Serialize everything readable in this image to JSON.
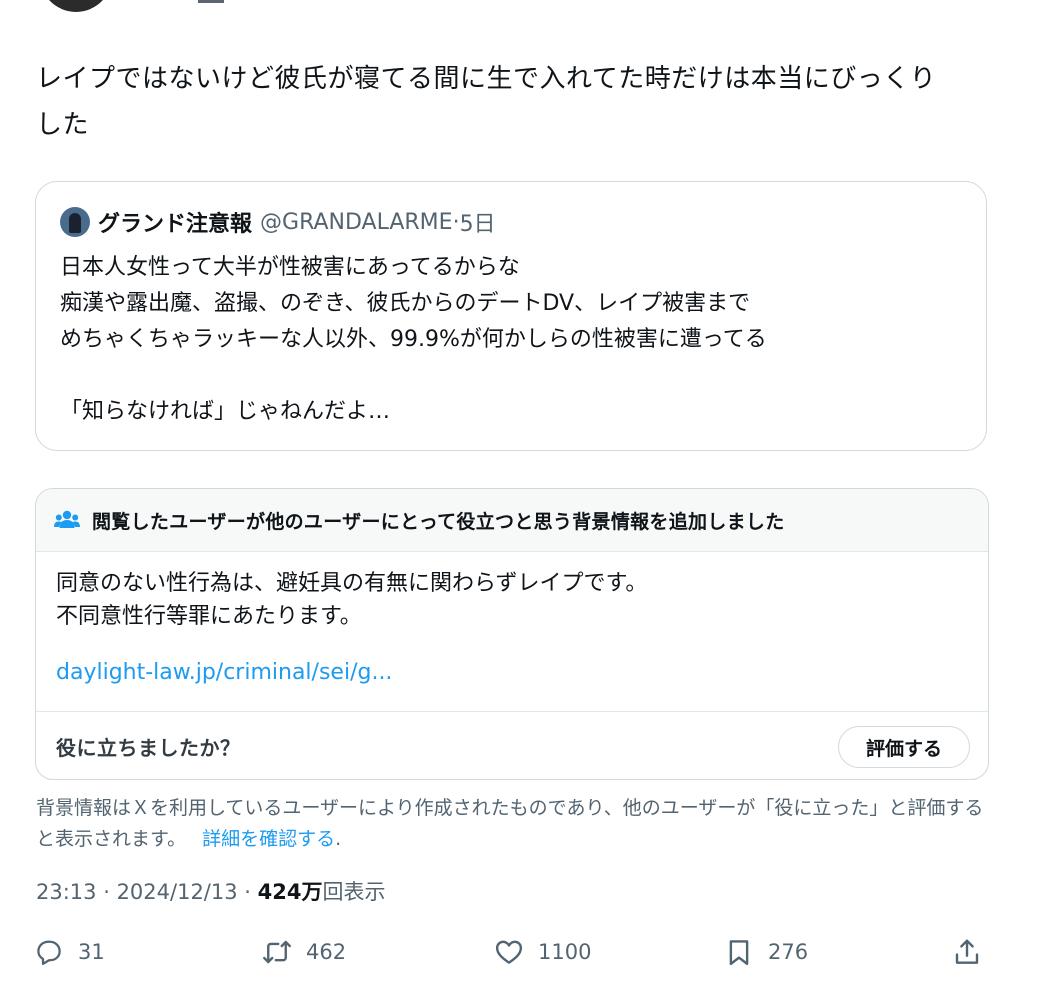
{
  "post": {
    "text": "レイプではないけど彼氏が寝てる間に生で入れてた時だけは本当にびっくり\nした"
  },
  "quote": {
    "author_name": "グランド注意報",
    "author_handle": "@GRANDALARME",
    "separator": "·",
    "age": "5日",
    "body": "日本人女性って大半が性被害にあってるからな\n痴漢や露出魔、盗撮、のぞき、彼氏からのデートDV、レイプ被害まで\nめちゃくちゃラッキーな人以外、99.9%が何かしらの性被害に遭ってる\n\n「知らなければ」じゃねんだよ…"
  },
  "note": {
    "title": "閲覧したユーザーが他のユーザーにとって役立つと思う背景情報を追加しました",
    "body": "同意のない性行為は、避妊具の有無に関わらずレイプです。\n不同意性行等罪にあたります。",
    "link_text": "daylight-law.jp/criminal/sei/g...",
    "helpful_question": "役に立ちましたか？",
    "rate_label": "評価する",
    "icon": "people-icon"
  },
  "disclaimer": {
    "text": "背景情報はＸを利用しているユーザーにより作成されたものであり、他のユーザーが「役に立った」と評価すると表示されます。",
    "link_text": "詳細を確認する",
    "trailing": "."
  },
  "meta": {
    "time": "23:13",
    "dot1": " · ",
    "date": "2024/12/13",
    "dot2": " · ",
    "views_count": "424万",
    "views_label": "回表示"
  },
  "actions": {
    "reply_count": "31",
    "repost_count": "462",
    "like_count": "1100",
    "bookmark_count": "276"
  },
  "colors": {
    "link": "#1d9bf0",
    "secondary_text": "#536471",
    "border": "#cfd9de"
  }
}
